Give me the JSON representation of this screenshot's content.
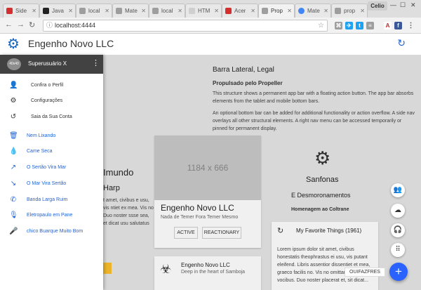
{
  "browser": {
    "tabs": [
      {
        "label": "Side",
        "color": "#d32f2f"
      },
      {
        "label": "Java",
        "color": "#222222"
      },
      {
        "label": "local",
        "color": "#9e9e9e"
      },
      {
        "label": "Mate",
        "color": "#9e9e9e"
      },
      {
        "label": "local",
        "color": "#9e9e9e"
      },
      {
        "label": "HTM",
        "color": "#cfcfcf"
      },
      {
        "label": "Acer",
        "color": "#d32f2f"
      },
      {
        "label": "Prop",
        "color": "#9e9e9e"
      },
      {
        "label": "Mate",
        "color": "#4285f4"
      },
      {
        "label": "prop",
        "color": "#9e9e9e"
      }
    ],
    "profile": "Celio",
    "url": "localhost:4444"
  },
  "appbar": {
    "title": "Engenho Novo LLC"
  },
  "drawer": {
    "avatar": "40x40",
    "user": "Superusuário X",
    "account_items": [
      {
        "icon": "person-icon",
        "label": "Confira o Perfil"
      },
      {
        "icon": "gear-icon",
        "label": "Configurações"
      },
      {
        "icon": "history-icon",
        "label": "Saia da Sua Conta"
      }
    ],
    "nav_items": [
      {
        "icon": "trash-icon",
        "label": "Nem Lixando"
      },
      {
        "icon": "drop-icon",
        "label": "Came Seca"
      },
      {
        "icon": "trending-up-icon",
        "label": "O Sertão Vira Mar"
      },
      {
        "icon": "trending-down-icon",
        "label": "O Mar Vira Sertão"
      },
      {
        "icon": "phone-off-icon",
        "label": "Banda Larga Ruim"
      },
      {
        "icon": "mic-off-icon",
        "label": "Eletropaulo em Pane"
      },
      {
        "icon": "mic-icon",
        "label": "chico Buarque Muito Bom"
      }
    ]
  },
  "article": {
    "title": "Barra Lateral, Legal",
    "subtitle": "Propulsado pelo Propeller",
    "p1": "This structure shows a permanent app bar with a floating action button. The app bar absorbs elements from the tablet and mobile bottom bars.",
    "p2": "An optional bottom bar can be added for additional functionality or action overflow. A side nav overlays all other structural elements. A right nav menu can be accessed temporarily or pinned for permanent display."
  },
  "left_column": {
    "heading": "Imundo",
    "subheading": "Harp",
    "text": "t amet, civibus e usu, vis ntiet ex mea. Vis no Duo noster ssse sea, et dicat usu salutatus"
  },
  "card_main": {
    "image_label": "1184 x 666",
    "title": "Engenho Novo LLC",
    "subtitle": "Nada de Temer Fora Temer Mesmo",
    "btn_active": "ACTIVE",
    "btn_reactionary": "REACTIONARY"
  },
  "card_small": {
    "title": "Engenho Novo LLC",
    "subtitle": "Deep in the heart of Samboja"
  },
  "right_column": {
    "heading": "Sanfonas",
    "subheading": "E Desmoronamentos",
    "tribute": "Homenagem ao Coltrane"
  },
  "card_music": {
    "title": "My Favorite Things (1961)",
    "text": "Lorem ipsum dolor sit amet, civibus honestatis theophrastus ei usu, vis putant eleifend. Libris assentior dissentiet et mea, graeco facilis no. Vis no omittam menandri vocibus. Duo noster placerat et, sit dicat..."
  },
  "fab": {
    "tooltip": "OUIFAZFRES"
  }
}
